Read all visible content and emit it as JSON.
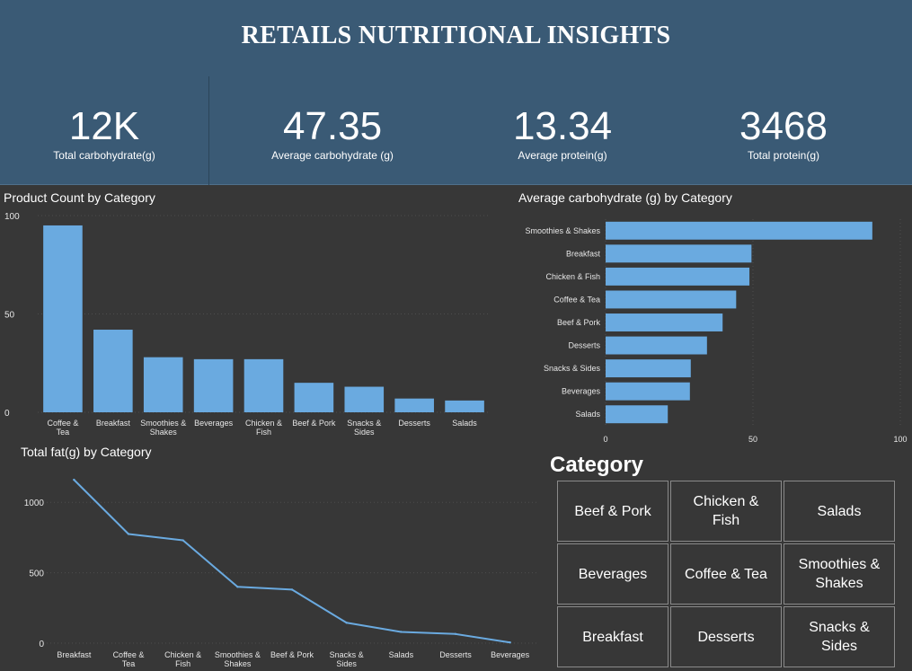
{
  "header": {
    "title": "RETAILS NUTRITIONAL INSIGHTS"
  },
  "kpis": [
    {
      "value": "12K",
      "label": "Total carbohydrate(g)"
    },
    {
      "value": "47.35",
      "label": "Average carbohydrate (g)"
    },
    {
      "value": "13.34",
      "label": "Average protein(g)"
    },
    {
      "value": "3468",
      "label": "Total protein(g)"
    }
  ],
  "colors": {
    "header_bg": "#3a5a75",
    "page_bg": "#373737",
    "bar": "#6aaae0",
    "line": "#6aaae0"
  },
  "slicer": {
    "title": "Category",
    "items": [
      "Beef & Pork",
      "Chicken & Fish",
      "Salads",
      "Beverages",
      "Coffee & Tea",
      "Smoothies & Shakes",
      "Breakfast",
      "Desserts",
      "Snacks & Sides"
    ]
  },
  "chart_data": [
    {
      "type": "bar",
      "title": "Product Count by Category",
      "categories": [
        "Coffee & Tea",
        "Breakfast",
        "Smoothies & Shakes",
        "Beverages",
        "Chicken & Fish",
        "Beef & Pork",
        "Snacks & Sides",
        "Desserts",
        "Salads"
      ],
      "values": [
        95,
        42,
        28,
        27,
        27,
        15,
        13,
        7,
        6
      ],
      "ylim": [
        0,
        100
      ],
      "yticks": [
        "0",
        "50",
        "100"
      ],
      "grid": true
    },
    {
      "type": "bar",
      "orientation": "horizontal",
      "title": "Average carbohydrate (g) by Category",
      "categories": [
        "Smoothies & Shakes",
        "Breakfast",
        "Chicken & Fish",
        "Coffee & Tea",
        "Beef & Pork",
        "Desserts",
        "Snacks & Sides",
        "Beverages",
        "Salads"
      ],
      "values": [
        90.5,
        49.5,
        48.8,
        44.3,
        39.7,
        34.4,
        28.9,
        28.6,
        21.1
      ],
      "xlim": [
        0,
        100
      ],
      "xticks": [
        "0",
        "50",
        "100"
      ],
      "grid": true
    },
    {
      "type": "line",
      "title": "Total fat(g) by Category",
      "categories": [
        "Breakfast",
        "Coffee & Tea",
        "Chicken & Fish",
        "Smoothies & Shakes",
        "Beef & Pork",
        "Snacks & Sides",
        "Salads",
        "Desserts",
        "Beverages"
      ],
      "values": [
        1160,
        775,
        730,
        400,
        380,
        145,
        80,
        65,
        5
      ],
      "ylim": [
        0,
        1250
      ],
      "yticks": [
        "0",
        "500",
        "1000"
      ],
      "grid": true
    }
  ]
}
